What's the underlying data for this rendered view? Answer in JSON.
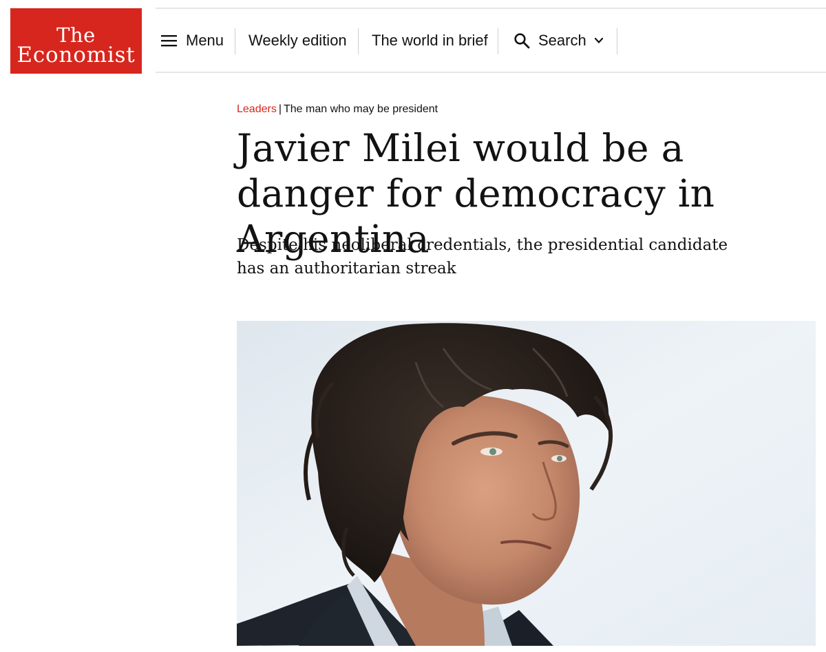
{
  "logo": {
    "line1": "The",
    "line2": "Economist",
    "color": "#d7261d"
  },
  "nav": {
    "menu_label": "Menu",
    "menu_icon": "hamburger-icon",
    "weekly_label": "Weekly edition",
    "brief_label": "The world in brief",
    "search_label": "Search",
    "search_icon": "search-icon",
    "dropdown_icon": "chevron-down-icon"
  },
  "article": {
    "section": "Leaders",
    "separator": "|",
    "fly_title": "The man who may be president",
    "headline": "Javier Milei would be a danger for democracy in Argentina",
    "standfirst": "Despite his neoliberal credentials, the presidential candidate has an authoritarian streak"
  },
  "colors": {
    "accent_red": "#d7261d",
    "text": "#121212",
    "divider": "#e6e6e6"
  }
}
